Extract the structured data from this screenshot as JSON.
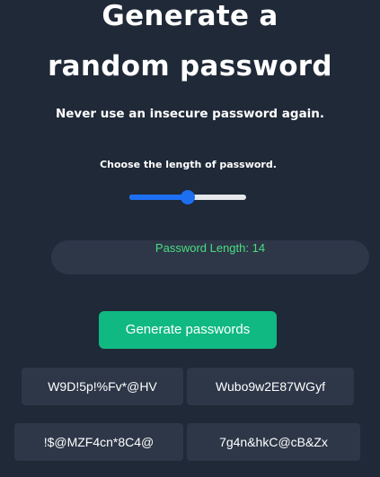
{
  "header": {
    "title_line1": "Generate a",
    "title_line2": "random password",
    "subtitle": "Never use an insecure password again."
  },
  "length_control": {
    "label": "Choose the length of password.",
    "slider_min": 8,
    "slider_max": 20,
    "slider_value": 14,
    "display": "Password Length: 14"
  },
  "generate_button": {
    "label": "Generate passwords"
  },
  "passwords": [
    "W9D!5p!%Fv*@HV",
    "Wubo9w2E87WGyf",
    "!$@MZF4cn*8C4@",
    "7g4n&hkC@cB&Zx"
  ]
}
